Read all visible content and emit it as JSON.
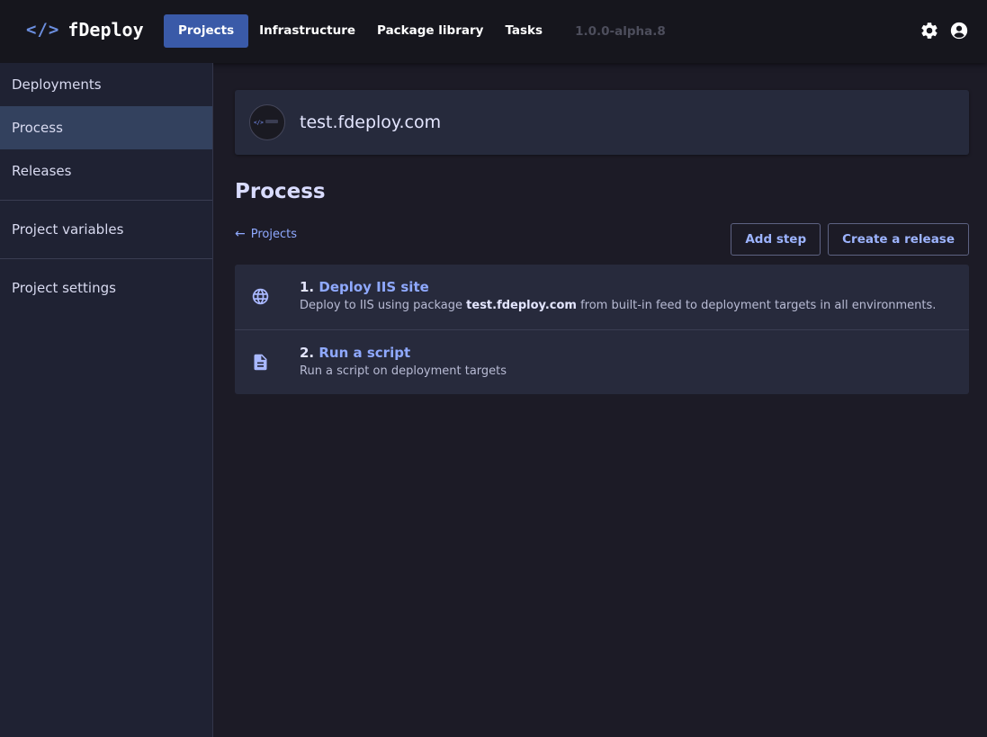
{
  "app": {
    "brand_icon": "</>",
    "brand_name": "fDeploy",
    "version": "1.0.0-alpha.8"
  },
  "nav": {
    "items": [
      {
        "label": "Projects",
        "active": true
      },
      {
        "label": "Infrastructure"
      },
      {
        "label": "Package library"
      },
      {
        "label": "Tasks"
      }
    ]
  },
  "icons": {
    "settings": "gear-icon",
    "account": "user-icon"
  },
  "sidebar": {
    "items": [
      {
        "label": "Deployments"
      },
      {
        "label": "Process",
        "active": true
      },
      {
        "label": "Releases"
      },
      {
        "label": "Project variables"
      },
      {
        "label": "Project settings"
      }
    ]
  },
  "project": {
    "name": "test.fdeploy.com"
  },
  "page": {
    "title": "Process",
    "back_link": "Projects",
    "add_step": "Add step",
    "create_release": "Create a release"
  },
  "steps": [
    {
      "number": "1.",
      "title": "Deploy IIS site",
      "icon": "globe-icon",
      "desc_pre": "Deploy to IIS using package ",
      "desc_bold": "test.fdeploy.com",
      "desc_post": " from built-in feed to deployment targets in all environments."
    },
    {
      "number": "2.",
      "title": "Run a script",
      "icon": "document-icon",
      "desc": "Run a script on deployment targets"
    }
  ],
  "colors": {
    "accent": "#3a5aa8",
    "link": "#8fa9ff",
    "background": "#1c1b26"
  }
}
